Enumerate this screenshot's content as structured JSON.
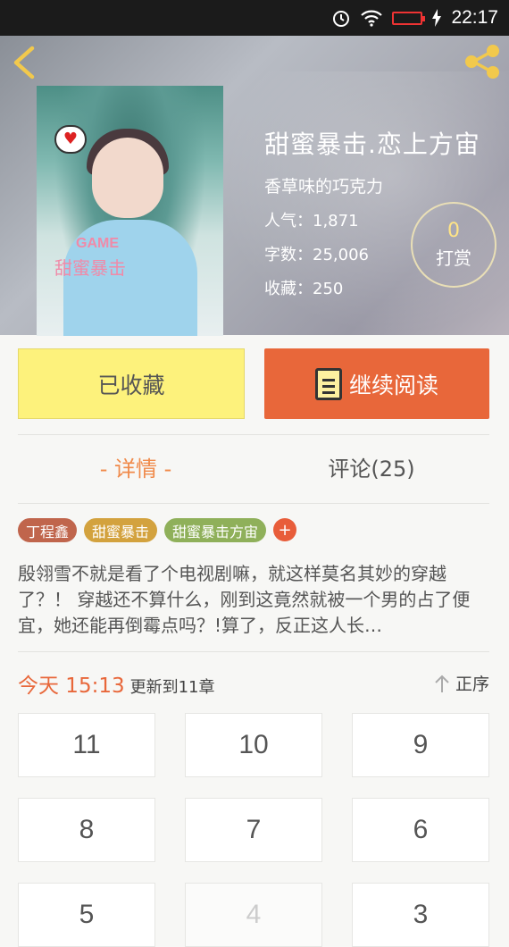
{
  "status_bar": {
    "time": "22:17"
  },
  "book": {
    "title": "甜蜜暴击.恋上方宙",
    "author": "香草味的巧克力",
    "popularity": "人气：1,871",
    "word_count": "字数：25,006",
    "favorites": "收藏：250",
    "cover_game": "GAME",
    "cover_name": "甜蜜暴击"
  },
  "reward": {
    "count": "0",
    "label": "打赏"
  },
  "actions": {
    "favorite_label": "已收藏",
    "read_label": "继续阅读"
  },
  "tabs": {
    "detail": "- 详情 -",
    "comments": "评论(25)"
  },
  "tags": [
    {
      "label": "丁程鑫",
      "color": "#c0654c"
    },
    {
      "label": "甜蜜暴击",
      "color": "#d3a23e"
    },
    {
      "label": "甜蜜暴击方宙",
      "color": "#8fb05a"
    }
  ],
  "tag_add": "+",
  "description": "殷翎雪不就是看了个电视剧嘛，就这样莫名其妙的穿越了？！ 穿越还不算什么，刚到这竟然就被一个男的占了便宜，她还能再倒霉点吗？!算了，反正这人长…",
  "update": {
    "time": "今天 15:13",
    "text": "更新到11章"
  },
  "sort_label": "正序",
  "chapters": [
    "11",
    "10",
    "9",
    "8",
    "7",
    "6",
    "5",
    "4",
    "3"
  ],
  "colors": {
    "accent": "#e8673a",
    "favorite_bg": "#fdf27c"
  }
}
